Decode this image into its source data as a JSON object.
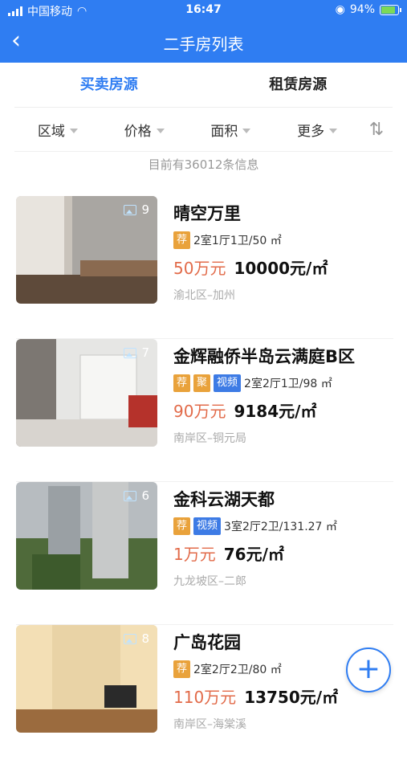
{
  "status": {
    "carrier": "中国移动",
    "time": "16:47",
    "battery": "94%",
    "battery_level": 0.94
  },
  "nav": {
    "title": "二手房列表"
  },
  "tabs": [
    {
      "label": "买卖房源",
      "active": true
    },
    {
      "label": "租赁房源",
      "active": false
    }
  ],
  "filters": [
    "区域",
    "价格",
    "面积",
    "更多"
  ],
  "info": "目前有36012条信息",
  "listings": [
    {
      "title": "晴空万里",
      "photos": "9",
      "tags": [
        "荐"
      ],
      "layout": "2室1厅1卫/50 ㎡",
      "price": "50万元",
      "unit_price": "10000元/㎡",
      "location": "渝北区–加州"
    },
    {
      "title": "金辉融侨半岛云满庭B区",
      "photos": "7",
      "tags": [
        "荐",
        "聚",
        "视频"
      ],
      "layout": "2室2厅1卫/98 ㎡",
      "price": "90万元",
      "unit_price": "9184元/㎡",
      "location": "南岸区–铜元局"
    },
    {
      "title": "金科云湖天都",
      "photos": "6",
      "tags": [
        "荐",
        "视频"
      ],
      "layout": "3室2厅2卫/131.27 ㎡",
      "price": "1万元",
      "unit_price": "76元/㎡",
      "location": "九龙坡区–二郎"
    },
    {
      "title": "广岛花园",
      "photos": "8",
      "tags": [
        "荐"
      ],
      "layout": "2室2厅2卫/80 ㎡",
      "price": "110万元",
      "unit_price": "13750元/㎡",
      "location": "南岸区–海棠溪"
    }
  ]
}
